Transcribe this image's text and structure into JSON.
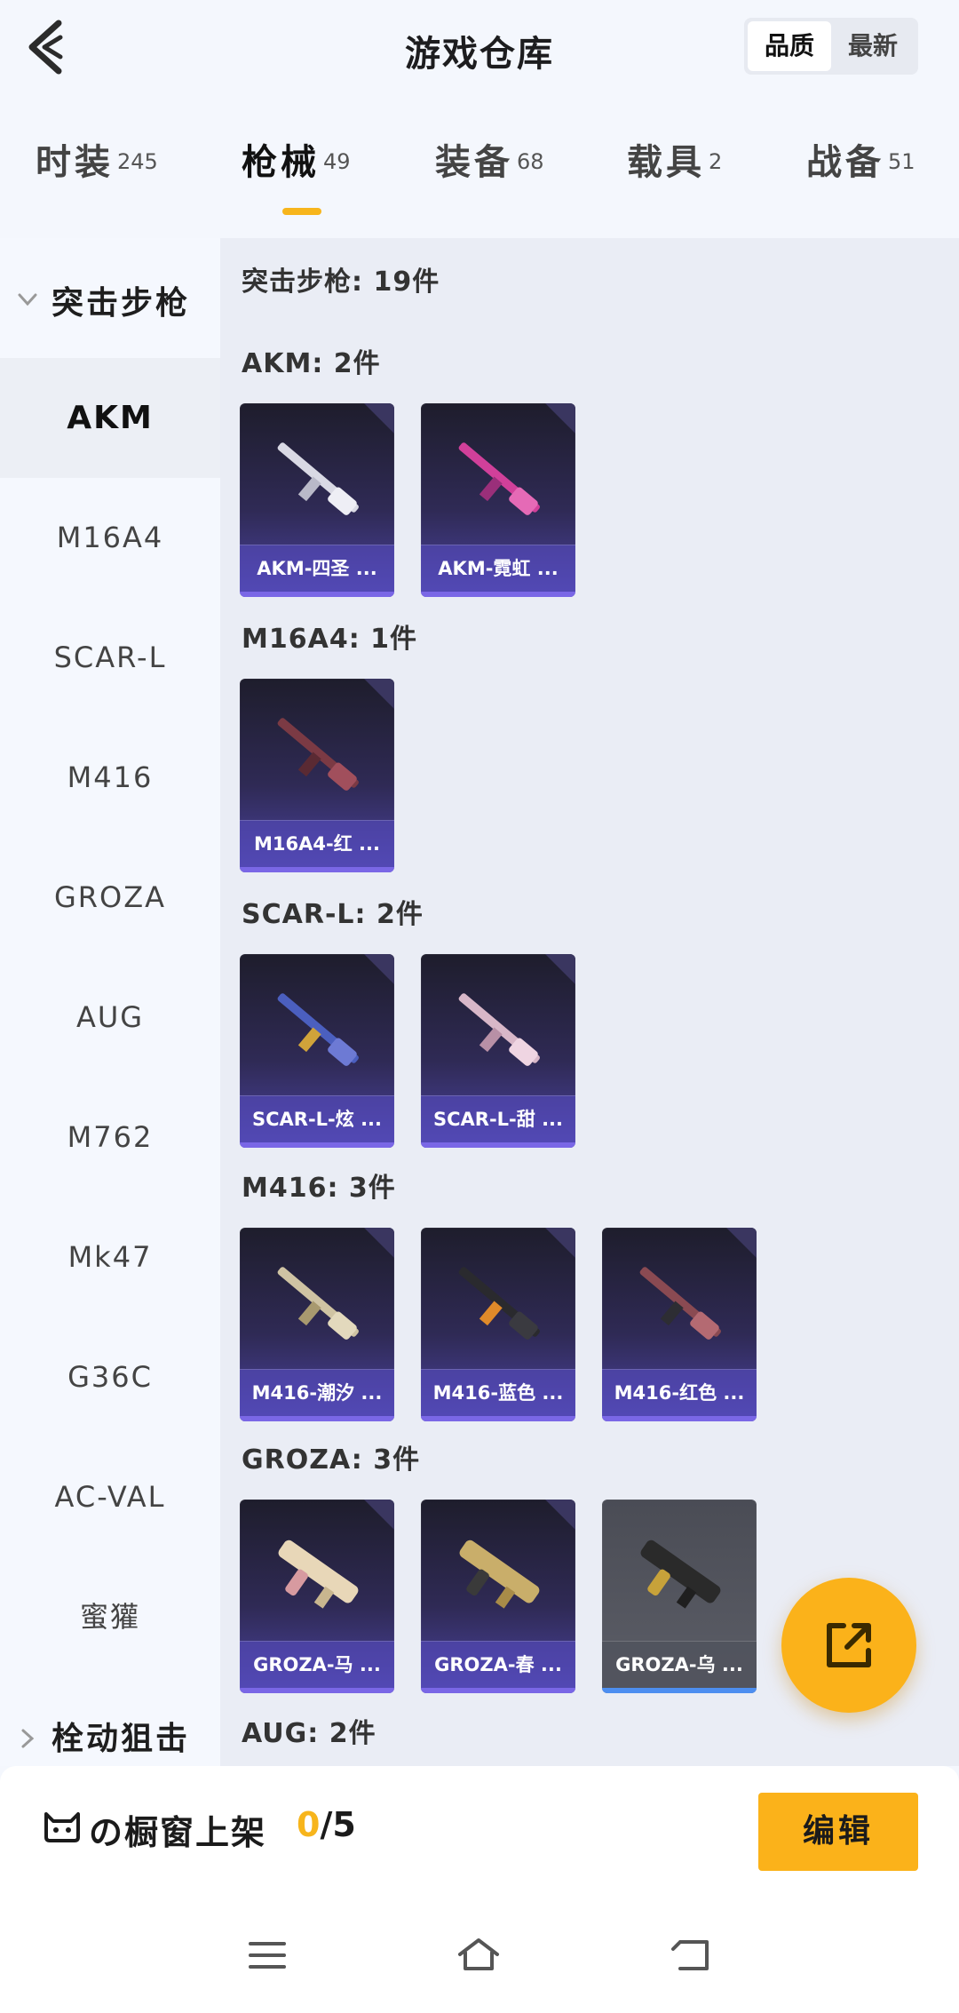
{
  "header": {
    "title": "游戏仓库",
    "sort_options": [
      "品质",
      "最新"
    ],
    "sort_active": "品质"
  },
  "tabs": [
    {
      "label": "时装",
      "count": "245"
    },
    {
      "label": "枪械",
      "count": "49"
    },
    {
      "label": "装备",
      "count": "68"
    },
    {
      "label": "载具",
      "count": "2"
    },
    {
      "label": "战备",
      "count": "51"
    }
  ],
  "active_tab": "枪械",
  "sidebar": {
    "group_expanded": "突击步枪",
    "items": [
      "AKM",
      "M16A4",
      "SCAR-L",
      "M416",
      "GROZA",
      "AUG",
      "M762",
      "Mk47",
      "G36C",
      "AC-VAL",
      "蜜獾"
    ],
    "active_item": "AKM",
    "group_collapsed": "栓动狙击"
  },
  "content": {
    "total": "突击步枪: 19件",
    "sections": [
      {
        "title": "AKM: 2件",
        "cards": [
          "AKM-四圣 ...",
          "AKM-霓虹 ..."
        ]
      },
      {
        "title": "M16A4: 1件",
        "cards": [
          "M16A4-红 ..."
        ]
      },
      {
        "title": "SCAR-L: 2件",
        "cards": [
          "SCAR-L-炫 ...",
          "SCAR-L-甜 ..."
        ]
      },
      {
        "title": "M416: 3件",
        "cards": [
          "M416-潮汐 ...",
          "M416-蓝色 ...",
          "M416-红色 ..."
        ]
      },
      {
        "title": "GROZA: 3件",
        "cards": [
          "GROZA-马 ...",
          "GROZA-春 ...",
          "GROZA-乌 ..."
        ]
      },
      {
        "title": "AUG: 2件",
        "cards": []
      }
    ]
  },
  "shelf": {
    "label": "の橱窗上架",
    "current": "0",
    "max": "/5",
    "edit_label": "编辑"
  },
  "colors": {
    "accent": "#fbb21a",
    "card_bar": "#7a67e6",
    "card_grey_bar": "#4d8ef0"
  }
}
